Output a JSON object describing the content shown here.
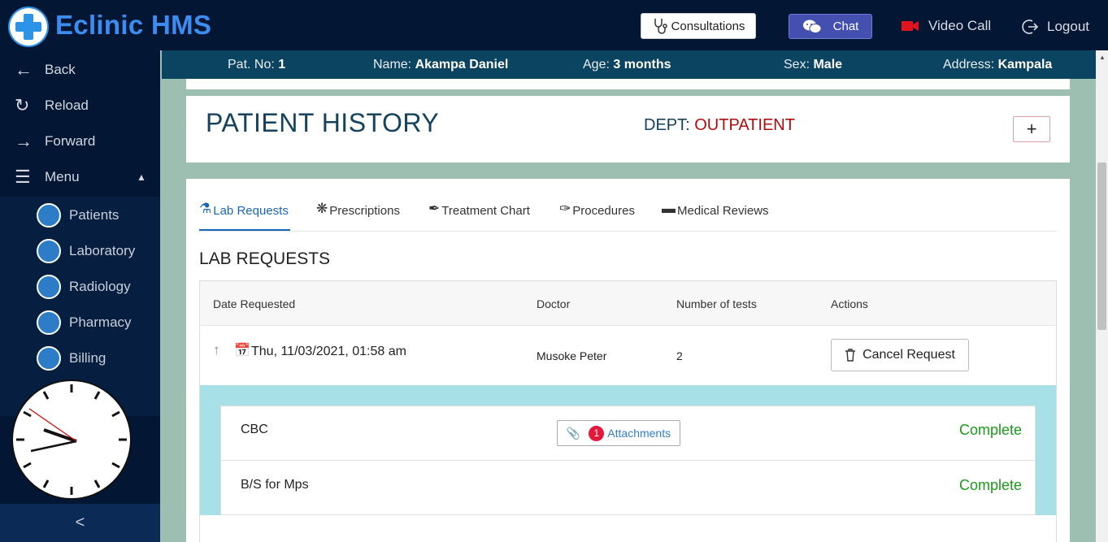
{
  "app": {
    "title": "Eclinic HMS"
  },
  "topbar": {
    "consultations_label": "Consultations",
    "chat_label": "Chat",
    "video_call_label": "Video Call",
    "logout_label": "Logout"
  },
  "sidebar": {
    "back_label": "Back",
    "reload_label": "Reload",
    "forward_label": "Forward",
    "menu_label": "Menu",
    "items": [
      {
        "label": "Patients",
        "icon": "patients-icon"
      },
      {
        "label": "Laboratory",
        "icon": "microscope-icon"
      },
      {
        "label": "Radiology",
        "icon": "heartbeat-icon"
      },
      {
        "label": "Pharmacy",
        "icon": "pills-icon"
      },
      {
        "label": "Billing",
        "icon": "billing-icon"
      }
    ],
    "collapse_glyph": "<"
  },
  "patient": {
    "no_label": "Pat. No:",
    "no": "1",
    "name_label": "Name:",
    "name": "Akampa Daniel",
    "age_label": "Age:",
    "age": "3 months",
    "sex_label": "Sex:",
    "sex": "Male",
    "address_label": "Address:",
    "address": "Kampala"
  },
  "history": {
    "title": "PATIENT HISTORY",
    "dept_label": "DEPT:",
    "dept_value": "OUTPATIENT",
    "add_label": "+"
  },
  "tabs": [
    {
      "label": "Lab Requests",
      "active": true
    },
    {
      "label": "Prescriptions",
      "active": false
    },
    {
      "label": "Treatment Chart",
      "active": false
    },
    {
      "label": "Procedures",
      "active": false
    },
    {
      "label": "Medical Reviews",
      "active": false
    }
  ],
  "lab": {
    "heading": "LAB REQUESTS",
    "columns": [
      "Date Requested",
      "Doctor",
      "Number of tests",
      "Actions"
    ],
    "request": {
      "date": "Thu, 11/03/2021, 01:58 am",
      "doctor": "Musoke Peter",
      "num_tests": "2",
      "cancel_label": "Cancel Request"
    },
    "tests": [
      {
        "name": "CBC",
        "status": "Complete",
        "attachments_label": "Attachments",
        "attachments_count": "1"
      },
      {
        "name": "B/S for Mps",
        "status": "Complete"
      }
    ]
  },
  "colors": {
    "sidebar_bg": "#031633",
    "accent": "#3c8df2",
    "patient_bar": "#0b4460",
    "complete": "#1b9a1b",
    "dept_value": "#b00d0d"
  }
}
